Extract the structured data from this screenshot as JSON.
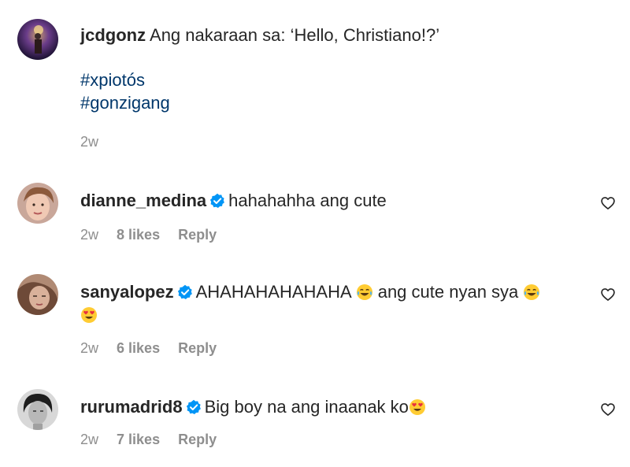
{
  "caption": {
    "username": "jcdgonz",
    "text": "Ang nakaraan sa: ‘Hello, Christiano!?’",
    "hashtags": [
      "#xpiotós",
      "#gonzigang"
    ],
    "time": "2w"
  },
  "comments": [
    {
      "username": "dianne_medina",
      "verified": true,
      "text": "hahahahha ang cute",
      "time": "2w",
      "likes": "8 likes",
      "reply": "Reply"
    },
    {
      "username": "sanyalopez",
      "verified": true,
      "text_a": "AHAHAHAHAHAHA",
      "text_b": "ang cute nyan sya",
      "time": "2w",
      "likes": "6 likes",
      "reply": "Reply"
    },
    {
      "username": "rurumadrid8",
      "verified": true,
      "text": "Big boy na ang inaanak ko",
      "time": "2w",
      "likes": "7 likes",
      "reply": "Reply"
    }
  ],
  "icons": {
    "heart": "heart-outline-icon",
    "verified": "verified-badge-icon"
  },
  "colors": {
    "text": "#262626",
    "secondary": "#8e8e8e",
    "hashtag": "#00376b",
    "verified": "#0095f6"
  }
}
